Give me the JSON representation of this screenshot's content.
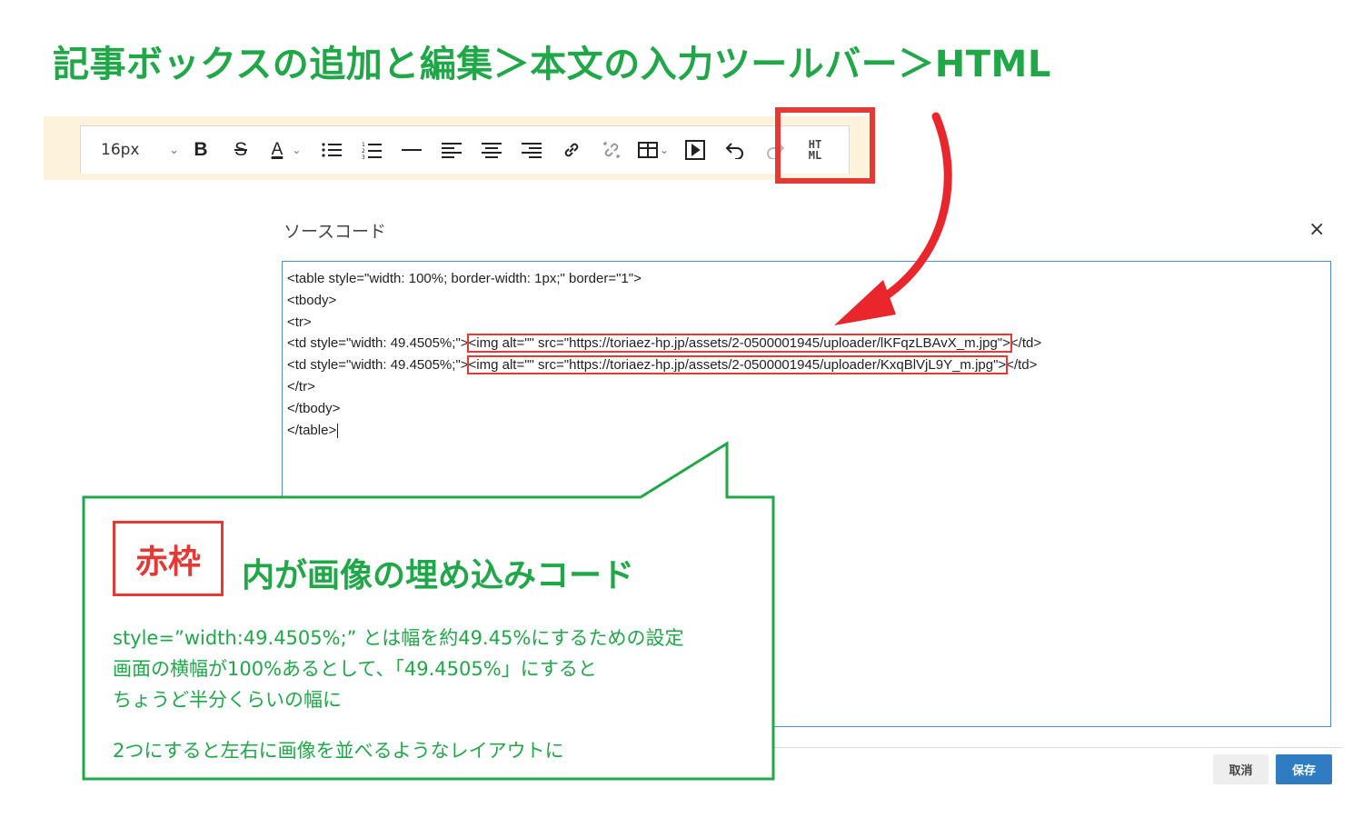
{
  "headline": "記事ボックスの追加と編集＞本文の入力ツールバー＞HTML",
  "toolbar": {
    "font_size": "16px",
    "bold": "B",
    "strike": "S",
    "font_color": "A",
    "html_top": "HT",
    "html_bottom": "ML",
    "icons": [
      "chevron-down-icon",
      "bold-icon",
      "strikethrough-icon",
      "font-color-icon",
      "bullet-list-icon",
      "numbered-list-icon",
      "horizontal-rule-icon",
      "align-left-icon",
      "align-center-icon",
      "align-right-icon",
      "link-icon",
      "unlink-icon",
      "table-icon",
      "media-icon",
      "undo-icon",
      "redo-icon",
      "html-icon"
    ]
  },
  "dialog": {
    "title": "ソースコード",
    "close": "×",
    "code": {
      "line1": "<table style=\"width: 100%; border-width: 1px;\" border=\"1\">",
      "line2": "<tbody>",
      "line3": "<tr>",
      "line4_prefix": "<td style=\"width: 49.4505%;\">",
      "line4_img": "<img alt=\"\" src=\"https://toriaez-hp.jp/assets/2-0500001945/uploader/lKFqzLBAvX_m.jpg\">",
      "line4_suffix": "</td>",
      "line5_prefix": "<td style=\"width: 49.4505%;\">",
      "line5_img": "<img alt=\"\" src=\"https://toriaez-hp.jp/assets/2-0500001945/uploader/KxqBlVjL9Y_m.jpg\">",
      "line5_suffix": "</td>",
      "line6": "</tr>",
      "line7": "</tbody>",
      "line8": "</table>"
    },
    "cancel": "取消",
    "save": "保存"
  },
  "callout": {
    "badge": "赤枠",
    "heading": "内が画像の埋め込みコード",
    "line1": "style=”width:49.4505%;” とは幅を約49.45%にするための設定",
    "line2": "画面の横幅が100%あるとして、「49.4505%」にすると",
    "line3": "ちょうど半分くらいの幅に",
    "line4": "2つにすると左右に画像を並べるようなレイアウトに"
  },
  "colors": {
    "green": "#20a848",
    "red": "#e53935",
    "toolbar_bg": "#fdf3dd",
    "save_blue": "#2f7cc3"
  }
}
